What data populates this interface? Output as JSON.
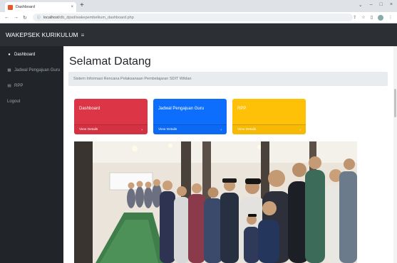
{
  "browser": {
    "tab_title": "Dashboard",
    "tab_close": "×",
    "new_tab": "+",
    "url_host": "localhost",
    "url_path": "/db_dpsd/wakepembelkum_dashboard.php",
    "window_controls": [
      "⌄",
      "–",
      "□",
      "×"
    ]
  },
  "navbar": {
    "brand": "WAKEPSEK KURIKULUM",
    "toggle_icon": "≡"
  },
  "sidebar": {
    "items": [
      {
        "icon": "dashboard-icon",
        "label": "Dashboard",
        "active": true
      },
      {
        "icon": "calendar-icon",
        "label": "Jadwal Pengajuan Guru",
        "active": false
      },
      {
        "icon": "file-icon",
        "label": "RPP",
        "active": false
      },
      {
        "icon": "",
        "label": "Logout",
        "active": false
      }
    ]
  },
  "main": {
    "title": "Selamat Datang",
    "subtitle": "Sistem Informasi Rencana Pelaksanaan Pembelajaran SDIT Wildan",
    "cards": [
      {
        "title": "Dashboard",
        "link": "View Details",
        "arrow": "›",
        "color": "#dc3545"
      },
      {
        "title": "Jadwal Pengajuan Guru",
        "link": "View Details",
        "arrow": "›",
        "color": "#0d6efd"
      },
      {
        "title": "RPP",
        "link": "View Details",
        "arrow": "›",
        "color": "#ffc107"
      }
    ]
  }
}
